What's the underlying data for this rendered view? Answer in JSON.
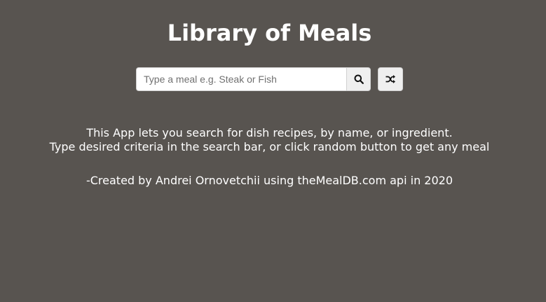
{
  "header": {
    "title": "Library of Meals"
  },
  "search": {
    "placeholder": "Type a meal e.g. Steak or Fish",
    "value": "",
    "search_icon": "search-icon",
    "random_icon": "shuffle-icon"
  },
  "description": {
    "line1": "This App lets you search for dish recipes, by name, or ingredient.",
    "line2": "Type desired criteria in the search bar, or click random button to get any meal"
  },
  "credit": "-Created by Andrei Ornovetchii using theMealDB.com api in 2020",
  "colors": {
    "background": "#585450",
    "text": "#ffffff",
    "button_bg": "#efefef"
  }
}
